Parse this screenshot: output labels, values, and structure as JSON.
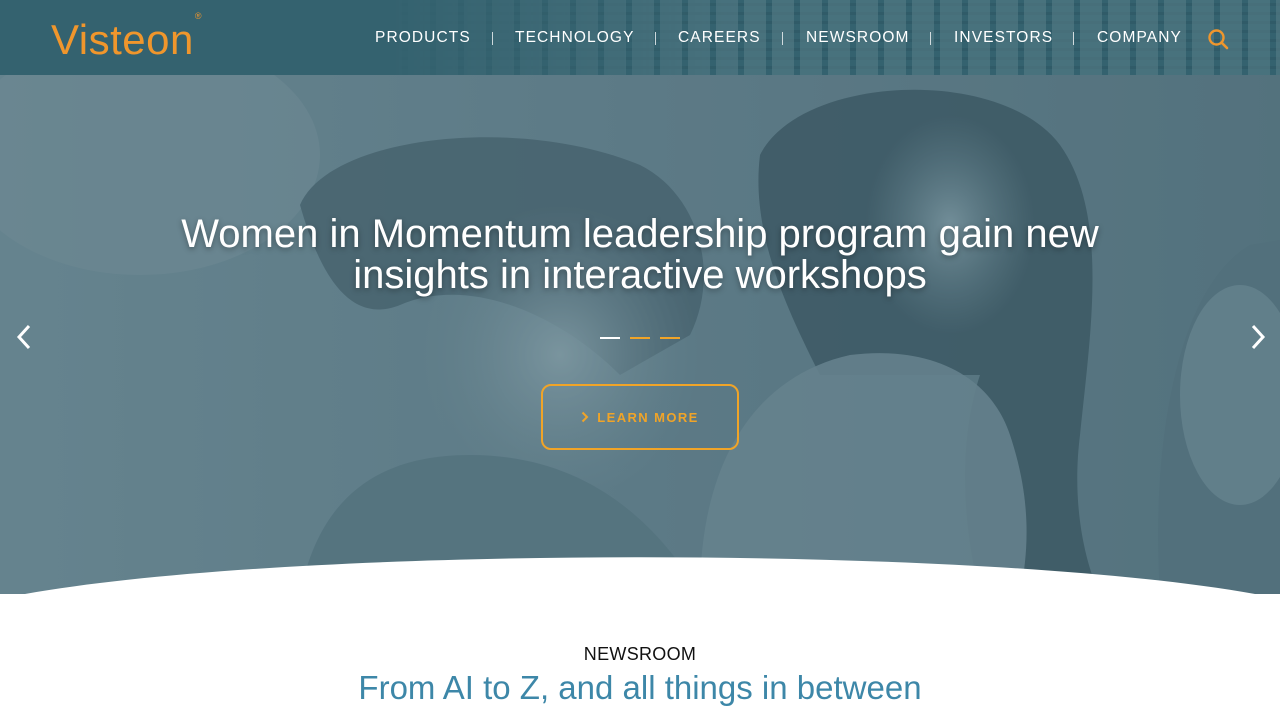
{
  "brand": {
    "logo_text": "Visteon",
    "logo_mark": "®",
    "accent_color": "#f0962c",
    "header_color": "#34626f"
  },
  "nav": {
    "items": [
      {
        "label": "PRODUCTS"
      },
      {
        "label": "TECHNOLOGY"
      },
      {
        "label": "CAREERS"
      },
      {
        "label": "NEWSROOM"
      },
      {
        "label": "INVESTORS"
      },
      {
        "label": "COMPANY"
      }
    ],
    "search_icon": "search-icon"
  },
  "hero": {
    "title": "Women in Momentum leadership program gain new insights in interactive workshops",
    "slide_count": 3,
    "active_slide": 1,
    "cta_label": "LEARN MORE",
    "prev_icon": "chevron-left-icon",
    "next_icon": "chevron-right-icon"
  },
  "newsroom": {
    "label": "NEWSROOM",
    "heading": "From AI to Z, and all things in between"
  }
}
